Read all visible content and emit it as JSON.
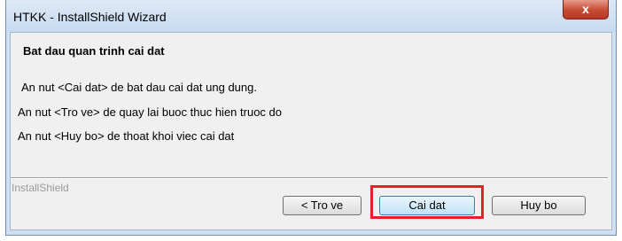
{
  "window": {
    "title": "HTKK - InstallShield Wizard",
    "close_label": "x"
  },
  "dialog": {
    "heading": "Bat dau quan trinh cai dat",
    "lines": [
      "An nut <Cai dat> de bat dau cai dat ung dung.",
      "An nut <Tro ve> de quay lai buoc thuc hien truoc do",
      "An nut <Huy bo> de thoat khoi viec cai dat"
    ],
    "brand": "InstallShield"
  },
  "buttons": {
    "back": "< Tro ve",
    "install": "Cai dat",
    "cancel": "Huy bo"
  },
  "colors": {
    "highlight": "#e5202a",
    "close_button": "#c74a34"
  }
}
